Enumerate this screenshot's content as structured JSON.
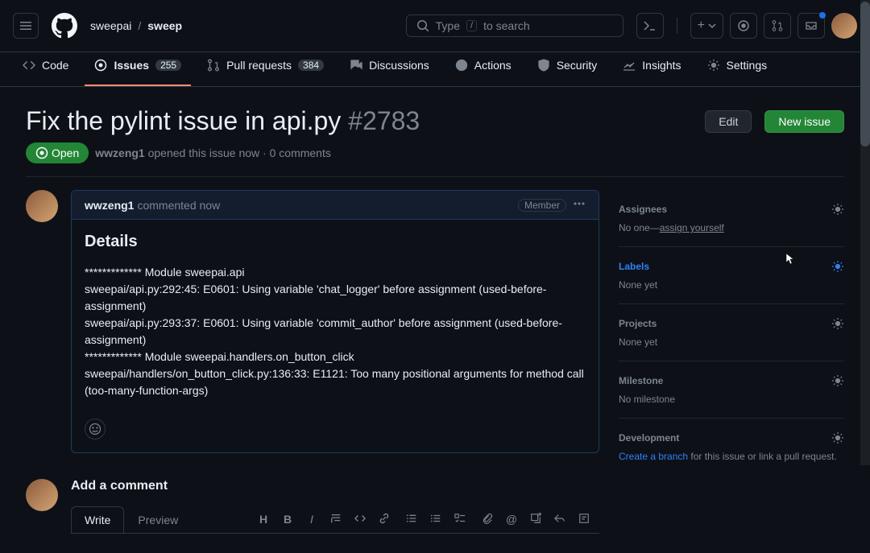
{
  "breadcrumb": {
    "owner": "sweepai",
    "repo": "sweep"
  },
  "search": {
    "placeholder": "to search",
    "hint": "Type",
    "key": "/"
  },
  "nav": {
    "code": "Code",
    "issues": "Issues",
    "issues_count": "255",
    "pulls": "Pull requests",
    "pulls_count": "384",
    "discussions": "Discussions",
    "actions": "Actions",
    "security": "Security",
    "insights": "Insights",
    "settings": "Settings"
  },
  "issue": {
    "title": "Fix the pylint issue in api.py",
    "number": "#2783",
    "state": "Open",
    "author": "wwzeng1",
    "meta_action": "opened this issue now",
    "meta_comments": "0 comments",
    "edit_btn": "Edit",
    "new_btn": "New issue"
  },
  "comment": {
    "author": "wwzeng1",
    "meta": "commented now",
    "badge": "Member",
    "heading": "Details",
    "body": "************* Module sweepai.api\nsweepai/api.py:292:45: E0601: Using variable 'chat_logger' before assignment (used-before-assignment)\nsweepai/api.py:293:37: E0601: Using variable 'commit_author' before assignment (used-before-assignment)\n************* Module sweepai.handlers.on_button_click\nsweepai/handlers/on_button_click.py:136:33: E1121: Too many positional arguments for method call (too-many-function-args)"
  },
  "add_comment": {
    "heading": "Add a comment",
    "write": "Write",
    "preview": "Preview"
  },
  "sidebar": {
    "assignees": {
      "label": "Assignees",
      "prefix": "No one—",
      "link": "assign yourself"
    },
    "labels": {
      "label": "Labels",
      "value": "None yet"
    },
    "projects": {
      "label": "Projects",
      "value": "None yet"
    },
    "milestone": {
      "label": "Milestone",
      "value": "No milestone"
    },
    "development": {
      "label": "Development",
      "link": "Create a branch",
      "suffix": " for this issue or link a pull request."
    }
  }
}
